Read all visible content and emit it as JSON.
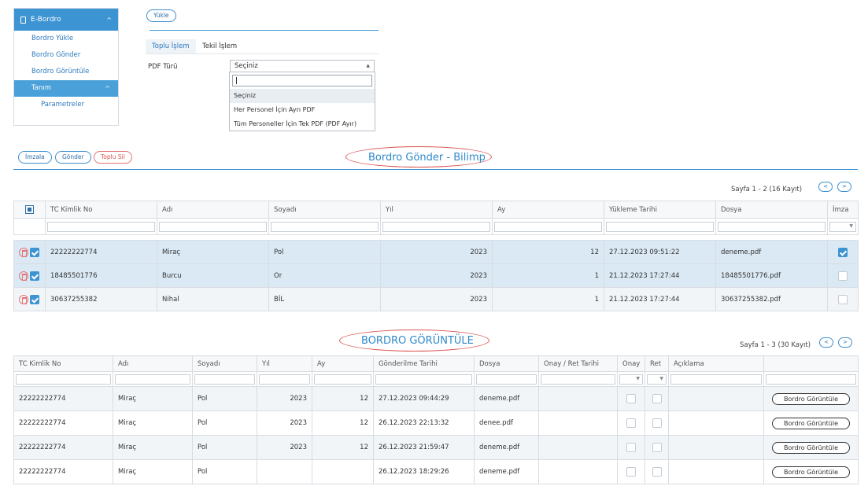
{
  "sidebar": {
    "title": "E-Bordro",
    "items": [
      {
        "label": "Bordro Yükle"
      },
      {
        "label": "Bordro Gönder"
      },
      {
        "label": "Bordro Görüntüle"
      }
    ],
    "group": {
      "label": "Tanım"
    },
    "sub_items": [
      {
        "label": "Parametreler"
      }
    ]
  },
  "upload": {
    "button_label": "Yükle"
  },
  "tabs": [
    {
      "label": "Toplu İşlem"
    },
    {
      "label": "Tekil İşlem"
    }
  ],
  "pdf_type": {
    "label": "PDF Türü",
    "selected": "Seçiniz",
    "search_value": "",
    "options": [
      "Seçiniz",
      "Her Personel İçin Ayrı PDF",
      "Tüm Personeller İçin Tek PDF (PDF Ayır)"
    ]
  },
  "actions": {
    "sign": "İmzala",
    "send": "Gönder",
    "bulk_delete": "Toplu Sil"
  },
  "send_section": {
    "heading": "Bordro Gönder - Bilimp",
    "pager": "Sayfa 1 - 2 (16 Kayıt)",
    "prev": "<",
    "next": ">",
    "columns": [
      "TC Kimlik No",
      "Adı",
      "Soyadı",
      "Yıl",
      "Ay",
      "Yükleme Tarihi",
      "Dosya",
      "İmza"
    ],
    "rows": [
      {
        "tc": "22222222774",
        "name": "Miraç",
        "surname": "Pol",
        "year": "2023",
        "month": "12",
        "date": "27.12.2023 09:51:22",
        "file": "deneme.pdf",
        "signed": true
      },
      {
        "tc": "18485501776",
        "name": "Burcu",
        "surname": "Or",
        "year": "2023",
        "month": "1",
        "date": "21.12.2023 17:27:44",
        "file": "18485501776.pdf",
        "signed": false
      },
      {
        "tc": "30637255382",
        "name": "Nihal",
        "surname": "BİL",
        "year": "2023",
        "month": "1",
        "date": "21.12.2023 17:27:44",
        "file": "30637255382.pdf",
        "signed": false
      }
    ]
  },
  "view_section": {
    "heading": "BORDRO GÖRÜNTÜLE",
    "pager": "Sayfa 1 - 3 (30 Kayıt)",
    "prev": "<",
    "next": ">",
    "columns": [
      "TC Kimlik No",
      "Adı",
      "Soyadı",
      "Yıl",
      "Ay",
      "Gönderilme Tarihi",
      "Dosya",
      "Onay / Ret Tarihi",
      "Onay",
      "Ret",
      "Açıklama"
    ],
    "view_button": "Bordro Görüntüle",
    "rows": [
      {
        "tc": "22222222774",
        "name": "Miraç",
        "surname": "Pol",
        "year": "2023",
        "month": "12",
        "date": "27.12.2023 09:44:29",
        "file": "deneme.pdf"
      },
      {
        "tc": "22222222774",
        "name": "Miraç",
        "surname": "Pol",
        "year": "2023",
        "month": "12",
        "date": "26.12.2023 22:13:32",
        "file": "denee.pdf"
      },
      {
        "tc": "22222222774",
        "name": "Miraç",
        "surname": "Pol",
        "year": "2023",
        "month": "12",
        "date": "26.12.2023 21:59:47",
        "file": "deneme.pdf"
      },
      {
        "tc": "22222222774",
        "name": "Miraç",
        "surname": "Pol",
        "year": "",
        "month": "",
        "date": "26.12.2023 18:29:26",
        "file": "deneme.pdf"
      }
    ]
  },
  "colors": {
    "accent": "#3d94d3",
    "danger": "#d9534f",
    "selected_row": "#dbe9f4"
  },
  "icons": {
    "doc": "document-icon",
    "caret": "chevron-up-icon",
    "delete": "delete-icon"
  }
}
